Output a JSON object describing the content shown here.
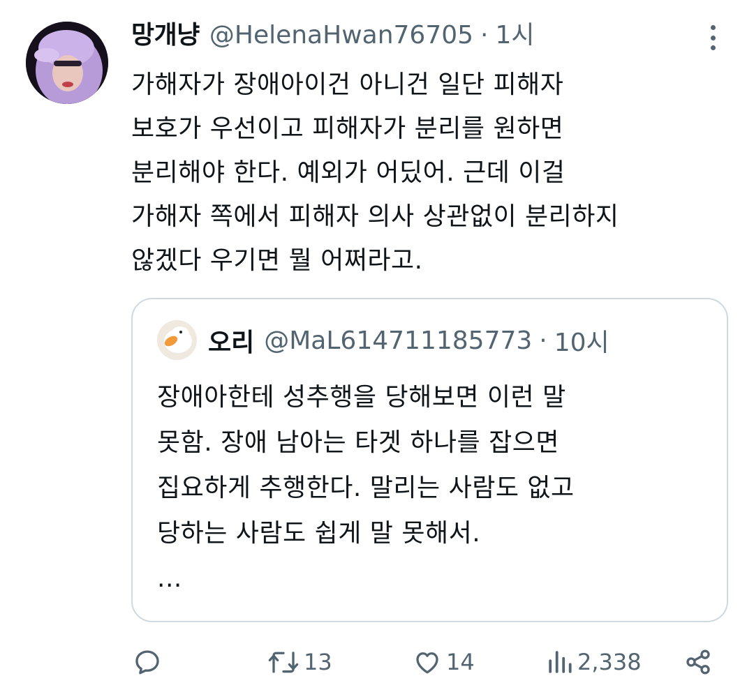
{
  "tweet": {
    "display_name": "망개냥",
    "handle": "@HelenaHwan76705",
    "separator": "·",
    "time": "1시",
    "lines": [
      "가해자가 장애아이건 아니건 일단 피해자",
      "보호가 우선이고 피해자가 분리를 원하면",
      "분리해야 한다. 예외가 어딨어. 근데 이걸",
      "가해자 쪽에서 피해자 의사 상관없이 분리하지",
      "않겠다 우기면 뭘 어쩌라고."
    ]
  },
  "quoted": {
    "display_name": "오리",
    "handle": "@MaL614711185773",
    "separator": "·",
    "time": "10시",
    "lines": [
      "장애아한테 성추행을 당해보면 이런 말",
      "못함. 장애 남아는 타겟 하나를 잡으면",
      "집요하게 추행한다. 말리는 사람도 없고",
      "당하는 사람도 쉽게 말 못해서.",
      "..."
    ]
  },
  "actions": {
    "replies": "",
    "retweets": "13",
    "likes": "14",
    "views": "2,338"
  },
  "icons": [
    "more-icon",
    "reply-icon",
    "retweet-icon",
    "like-icon",
    "views-icon",
    "share-icon"
  ],
  "colors": {
    "text": "#0f1419",
    "secondary": "#536471",
    "border": "#cfd9de"
  }
}
